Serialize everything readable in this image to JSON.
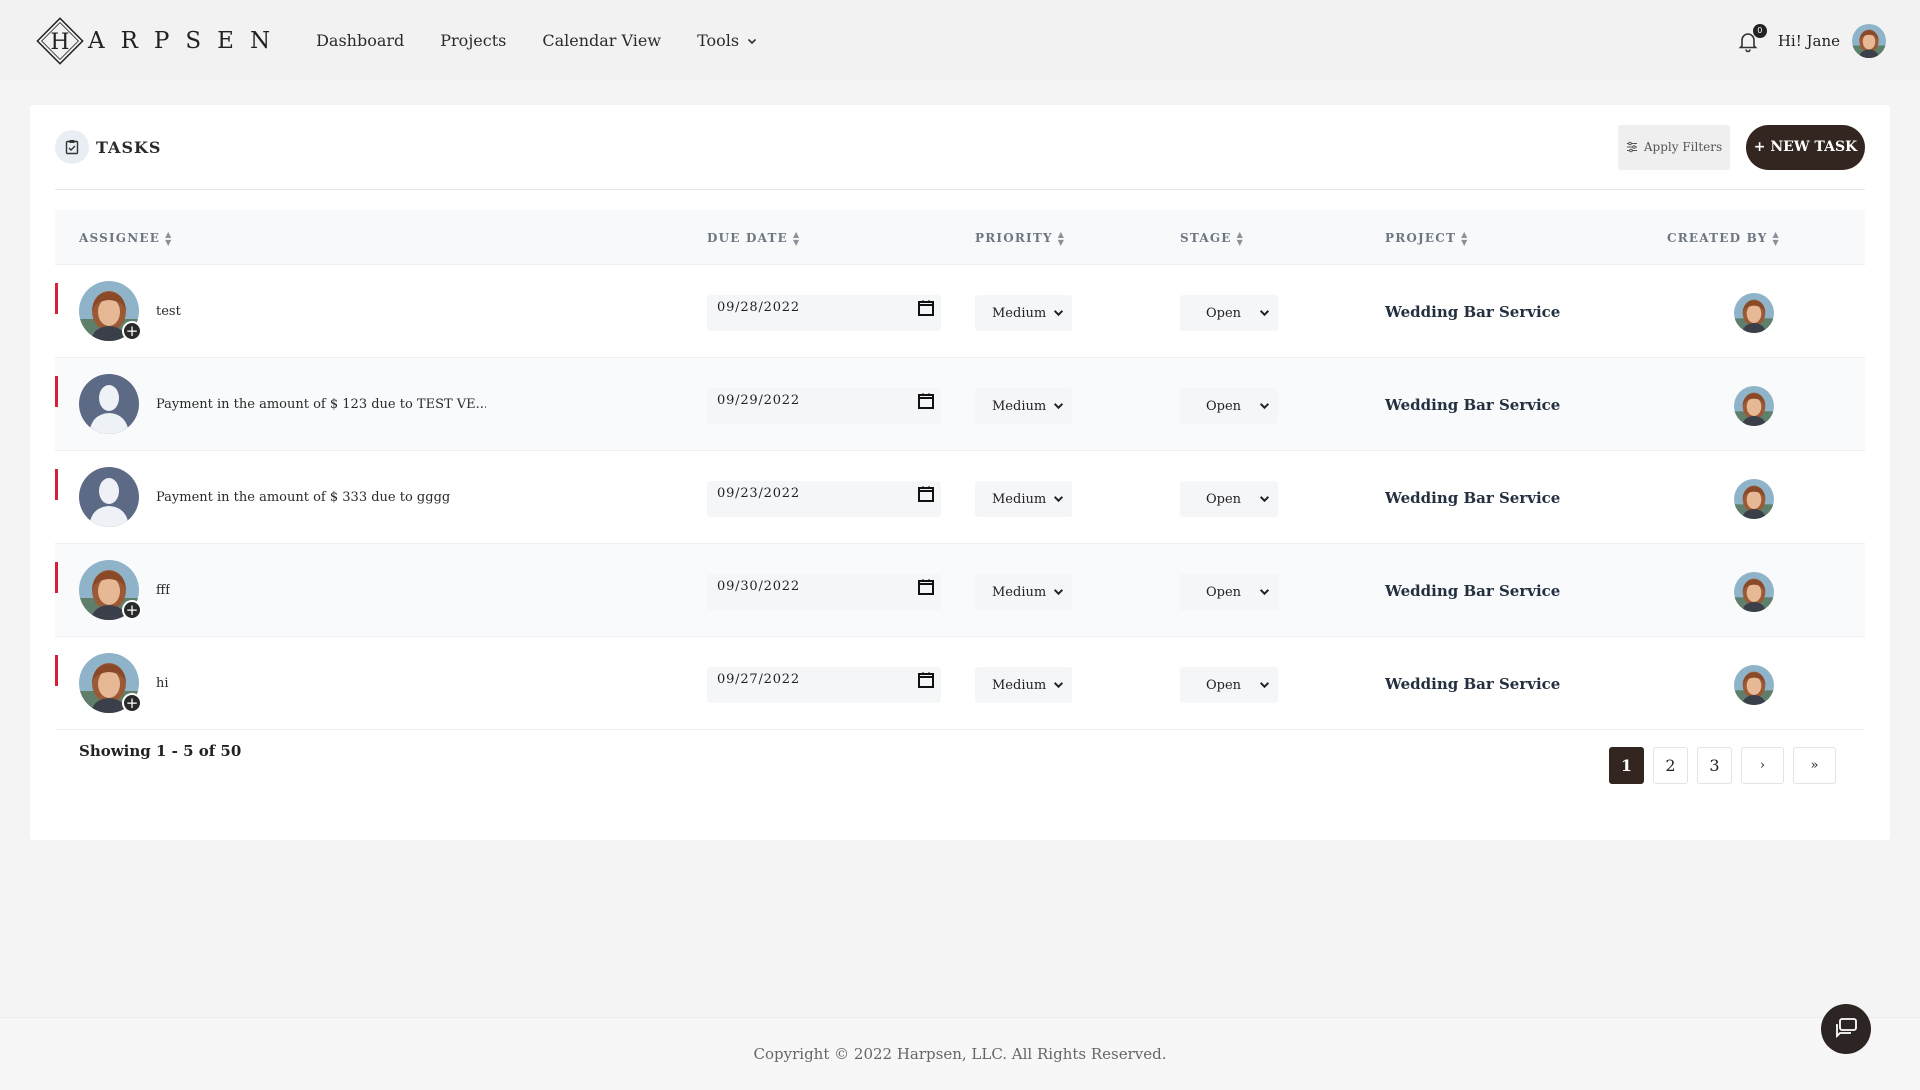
{
  "brand": {
    "name": "ARPSEN",
    "mark_letter": "H"
  },
  "nav": {
    "items": [
      {
        "label": "Dashboard"
      },
      {
        "label": "Projects"
      },
      {
        "label": "Calendar View"
      },
      {
        "label": "Tools"
      }
    ]
  },
  "header": {
    "notification_count": "0",
    "greeting": "Hi! Jane"
  },
  "tasks": {
    "title": "TASKS",
    "apply_filters_label": "Apply Filters",
    "new_task_label": "+ NEW TASK",
    "columns": {
      "assignee": "ASSIGNEE",
      "due_date": "DUE DATE",
      "priority": "PRIORITY",
      "stage": "STAGE",
      "project": "PROJECT",
      "created_by": "CREATED BY"
    },
    "rows": [
      {
        "name": "test",
        "assignee": "photo",
        "due_date": "09/28/2022",
        "priority": "Medium",
        "stage": "Open",
        "project": "Wedding Bar Service"
      },
      {
        "name": "Payment in the amount of $ 123 due to TEST VE...",
        "assignee": "placeholder",
        "due_date": "09/29/2022",
        "priority": "Medium",
        "stage": "Open",
        "project": "Wedding Bar Service"
      },
      {
        "name": "Payment in the amount of $ 333 due to gggg",
        "assignee": "placeholder",
        "due_date": "09/23/2022",
        "priority": "Medium",
        "stage": "Open",
        "project": "Wedding Bar Service"
      },
      {
        "name": "fff",
        "assignee": "photo",
        "due_date": "09/30/2022",
        "priority": "Medium",
        "stage": "Open",
        "project": "Wedding Bar Service"
      },
      {
        "name": "hi",
        "assignee": "photo",
        "due_date": "09/27/2022",
        "priority": "Medium",
        "stage": "Open",
        "project": "Wedding Bar Service"
      }
    ],
    "showing": "Showing 1 - 5 of 50",
    "pagination": {
      "pages": [
        "1",
        "2",
        "3"
      ],
      "next": "›",
      "last": "»"
    }
  },
  "footer": {
    "copyright": "Copyright © 2022 Harpsen, LLC. All Rights Reserved."
  },
  "colors": {
    "accent": "#33251f",
    "priority_bar": "#d61f3a",
    "header_bg": "#f2f2f2"
  }
}
